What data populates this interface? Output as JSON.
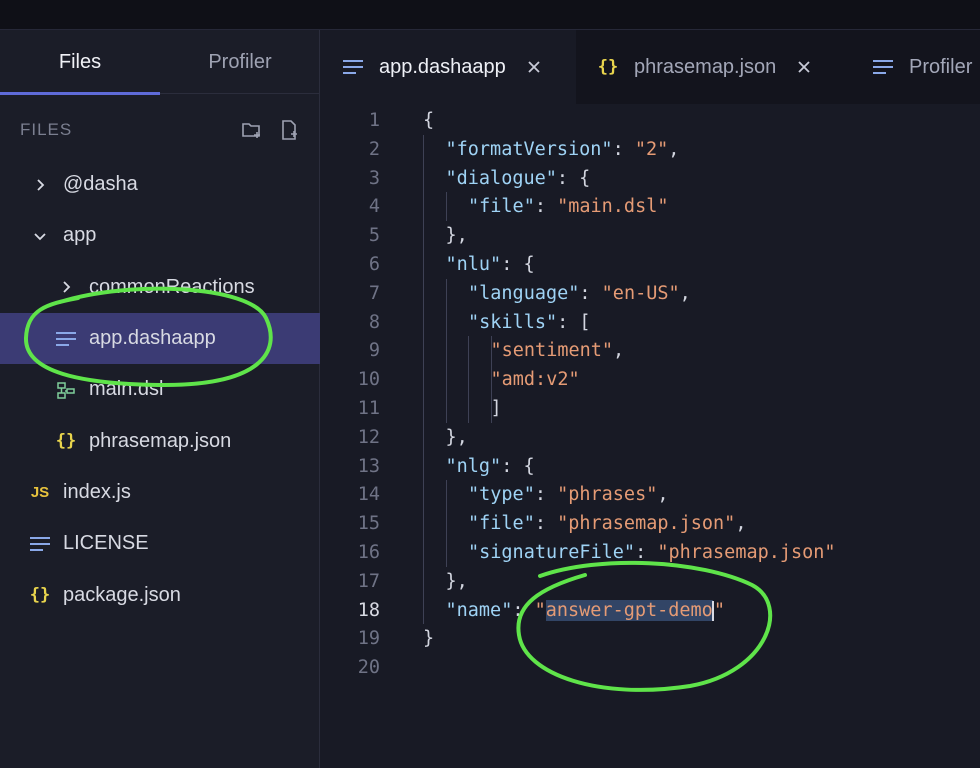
{
  "sidebar": {
    "tabs": [
      {
        "label": "Files",
        "active": true
      },
      {
        "label": "Profiler",
        "active": false
      }
    ],
    "files_title": "FILES",
    "header_icons": [
      "new-folder-icon",
      "new-file-icon"
    ],
    "tree": [
      {
        "label": "@dasha",
        "icon": "chevron-right-icon",
        "depth": 0
      },
      {
        "label": "app",
        "icon": "chevron-down-icon",
        "depth": 0
      },
      {
        "label": "commonReactions",
        "icon": "chevron-right-icon",
        "depth": 1
      },
      {
        "label": "app.dashaapp",
        "icon": "lines-icon",
        "depth": 1,
        "selected": true
      },
      {
        "label": "main.dsl",
        "icon": "dsl-file-icon",
        "depth": 1
      },
      {
        "label": "phrasemap.json",
        "icon": "json-braces-icon",
        "depth": 1
      },
      {
        "label": "index.js",
        "icon": "js-icon",
        "depth": 0
      },
      {
        "label": "LICENSE",
        "icon": "lines-icon",
        "depth": 0
      },
      {
        "label": "package.json",
        "icon": "json-braces-icon",
        "depth": 0
      }
    ]
  },
  "editor_tabs": [
    {
      "label": "app.dashaapp",
      "icon": "lines-icon",
      "active": true,
      "closable": true
    },
    {
      "label": "phrasemap.json",
      "icon": "json-braces-icon",
      "active": false,
      "closable": true
    },
    {
      "label": "Profiler",
      "icon": "lines-icon",
      "active": false,
      "closable": false
    }
  ],
  "code": {
    "current_line": 18,
    "lines": [
      [
        [
          "p",
          "{"
        ]
      ],
      [
        [
          "k",
          "\"formatVersion\""
        ],
        [
          "p",
          ": "
        ],
        [
          "s",
          "\"2\""
        ],
        [
          "p",
          ","
        ]
      ],
      [
        [
          "k",
          "\"dialogue\""
        ],
        [
          "p",
          ": {"
        ]
      ],
      [
        [
          "k",
          "\"file\""
        ],
        [
          "p",
          ": "
        ],
        [
          "s",
          "\"main.dsl\""
        ]
      ],
      [
        [
          "p",
          "},"
        ]
      ],
      [
        [
          "k",
          "\"nlu\""
        ],
        [
          "p",
          ": {"
        ]
      ],
      [
        [
          "k",
          "\"language\""
        ],
        [
          "p",
          ": "
        ],
        [
          "s",
          "\"en-US\""
        ],
        [
          "p",
          ","
        ]
      ],
      [
        [
          "k",
          "\"skills\""
        ],
        [
          "p",
          ": ["
        ]
      ],
      [
        [
          "s",
          "\"sentiment\""
        ],
        [
          "p",
          ","
        ]
      ],
      [
        [
          "s",
          "\"amd:v2\""
        ]
      ],
      [
        [
          "p",
          "]"
        ]
      ],
      [
        [
          "p",
          "},"
        ]
      ],
      [
        [
          "k",
          "\"nlg\""
        ],
        [
          "p",
          ": {"
        ]
      ],
      [
        [
          "k",
          "\"type\""
        ],
        [
          "p",
          ": "
        ],
        [
          "s",
          "\"phrases\""
        ],
        [
          "p",
          ","
        ]
      ],
      [
        [
          "k",
          "\"file\""
        ],
        [
          "p",
          ": "
        ],
        [
          "s",
          "\"phrasemap.json\""
        ],
        [
          "p",
          ","
        ]
      ],
      [
        [
          "k",
          "\"signatureFile\""
        ],
        [
          "p",
          ": "
        ],
        [
          "s",
          "\"phrasemap.json\""
        ]
      ],
      [
        [
          "p",
          "},"
        ]
      ],
      [
        [
          "k",
          "\"name\""
        ],
        [
          "p",
          ": "
        ],
        [
          "s",
          "\""
        ],
        [
          "sel",
          "answer-gpt-demo"
        ],
        [
          "caret",
          ""
        ],
        [
          "s",
          "\""
        ]
      ],
      [
        [
          "p",
          "}"
        ]
      ],
      []
    ]
  },
  "annotation_color": "#5fe44a"
}
